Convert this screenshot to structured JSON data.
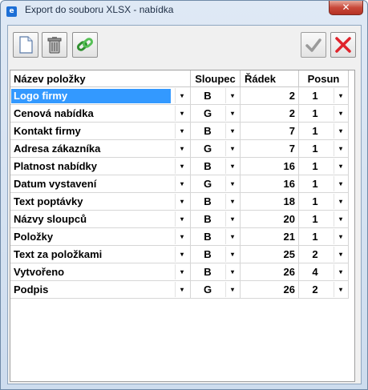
{
  "window": {
    "title": "Export do souboru XLSX - nabídka",
    "close_label": "✕"
  },
  "toolbar": {
    "new_icon": "new-document-icon",
    "delete_icon": "trash-icon",
    "link_icon": "link-icon",
    "confirm_icon": "checkmark-icon",
    "cancel_icon": "red-x-icon"
  },
  "table": {
    "headers": {
      "name": "Název položky",
      "column": "Sloupec",
      "row": "Řádek",
      "shift": "Posun"
    },
    "dropdown_glyph": "▾",
    "rows": [
      {
        "name": "Logo firmy",
        "column": "B",
        "row": "2",
        "shift": "1",
        "selected": true
      },
      {
        "name": "Cenová nabídka",
        "column": "G",
        "row": "2",
        "shift": "1"
      },
      {
        "name": "Kontakt firmy",
        "column": "B",
        "row": "7",
        "shift": "1"
      },
      {
        "name": "Adresa zákazníka",
        "column": "G",
        "row": "7",
        "shift": "1"
      },
      {
        "name": "Platnost nabídky",
        "column": "B",
        "row": "16",
        "shift": "1"
      },
      {
        "name": "Datum vystavení",
        "column": "G",
        "row": "16",
        "shift": "1"
      },
      {
        "name": "Text poptávky",
        "column": "B",
        "row": "18",
        "shift": "1"
      },
      {
        "name": "Názvy sloupců",
        "column": "B",
        "row": "20",
        "shift": "1"
      },
      {
        "name": "Položky",
        "column": "B",
        "row": "21",
        "shift": "1"
      },
      {
        "name": "Text za položkami",
        "column": "B",
        "row": "25",
        "shift": "2"
      },
      {
        "name": "Vytvořeno",
        "column": "B",
        "row": "26",
        "shift": "4"
      },
      {
        "name": "Podpis",
        "column": "G",
        "row": "26",
        "shift": "2"
      }
    ]
  }
}
